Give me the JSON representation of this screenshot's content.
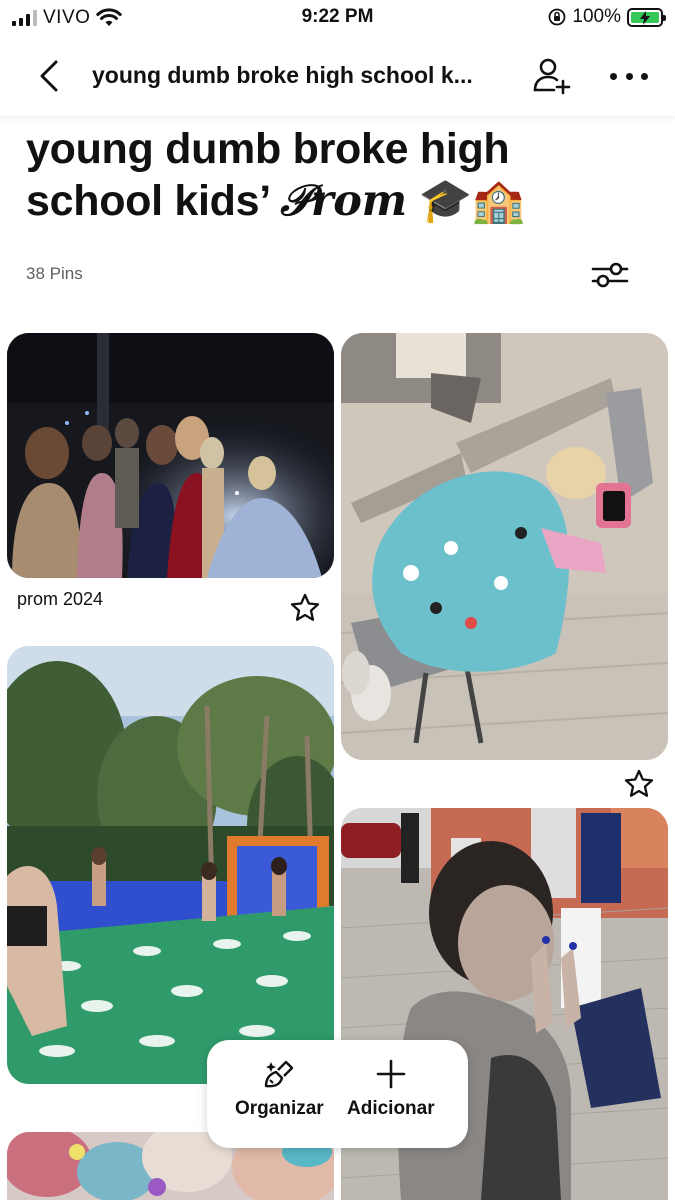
{
  "status_bar": {
    "carrier": "VIVO",
    "time": "9:22 PM",
    "battery": "100%",
    "battery_level": 1.0
  },
  "header": {
    "title": "young dumb broke high school k...",
    "icons": [
      "chevron-left-icon",
      "add-person-icon",
      "more-dots-icon"
    ]
  },
  "board": {
    "title_main": "young dumb broke high school kids’ ",
    "title_script": "𝒫rom",
    "title_emoji": "🎓🏫",
    "pin_count": "38 Pins"
  },
  "pins": [
    {
      "id": "prom-2024",
      "caption": "prom 2024",
      "description": "prom dance photo"
    },
    {
      "id": "classroom-sleep",
      "caption": ""
    },
    {
      "id": "inflatable",
      "caption": ""
    },
    {
      "id": "flour-fight",
      "caption": ""
    },
    {
      "id": "paint",
      "caption": ""
    }
  ],
  "action_bar": {
    "organize_label": "Organizar",
    "add_label": "Adicionar"
  },
  "colors": {
    "battery_green": "#34c759",
    "text": "#111111",
    "muted": "#5f5f5f"
  }
}
